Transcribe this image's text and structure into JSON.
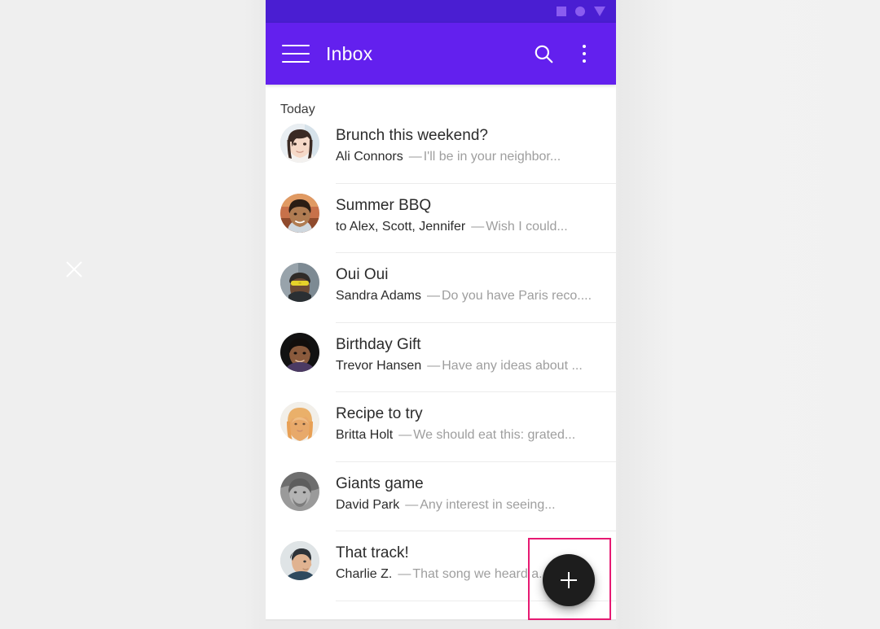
{
  "window": {
    "background_color": "#f1f1f1"
  },
  "close_marker": {
    "icon": "close-x-icon",
    "color": "#ffffff"
  },
  "phone": {
    "status_bar": {
      "background_color": "#4a1ed2",
      "icons": [
        "square-icon",
        "circle-icon",
        "triangle-down-icon"
      ],
      "icon_color": "#8a5cf0"
    },
    "app_bar": {
      "background_color": "#6320ee",
      "menu_icon": "hamburger-menu-icon",
      "title": "Inbox",
      "search_icon": "search-icon",
      "overflow_icon": "more-vert-icon"
    },
    "list": {
      "section_header": "Today",
      "items": [
        {
          "subject": "Brunch this weekend?",
          "sender": "Ali Connors",
          "dash": "—",
          "snippet": "I'll be in your neighbor...",
          "avatar": "avatar-ali-connors"
        },
        {
          "subject": "Summer BBQ",
          "sender": "to Alex, Scott, Jennifer",
          "dash": "—",
          "snippet": "Wish I could...",
          "avatar": "avatar-summer-bbq"
        },
        {
          "subject": "Oui Oui",
          "sender": "Sandra Adams",
          "dash": "—",
          "snippet": "Do you have Paris reco....",
          "avatar": "avatar-sandra-adams"
        },
        {
          "subject": "Birthday Gift",
          "sender": "Trevor Hansen",
          "dash": "—",
          "snippet": "Have any ideas about ...",
          "avatar": "avatar-trevor-hansen"
        },
        {
          "subject": "Recipe to try",
          "sender": "Britta Holt",
          "dash": "—",
          "snippet": "We should eat this: grated...",
          "avatar": "avatar-britta-holt"
        },
        {
          "subject": "Giants game",
          "sender": "David Park",
          "dash": "—",
          "snippet": "Any interest in seeing...",
          "avatar": "avatar-david-park"
        },
        {
          "subject": "That track!",
          "sender": "Charlie Z.",
          "dash": "—",
          "snippet": "That song we heard a...",
          "avatar": "avatar-charlie-z"
        }
      ]
    },
    "fab": {
      "icon": "plus-icon",
      "background_color": "#1d1d1d",
      "icon_color": "#ffffff"
    }
  },
  "annotation": {
    "highlight_color": "#e61a72"
  }
}
